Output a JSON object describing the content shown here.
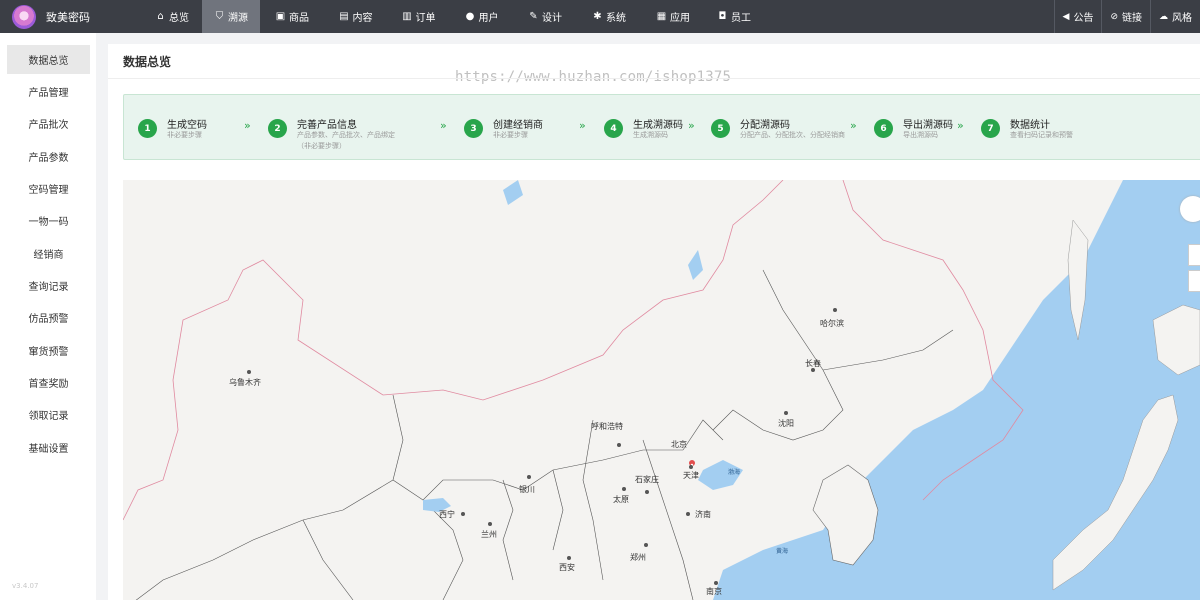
{
  "app": {
    "name": "致美密码",
    "version": "v3.4.07"
  },
  "nav": [
    {
      "label": "总览",
      "icon": "home-icon",
      "active": false
    },
    {
      "label": "溯源",
      "icon": "shield-icon",
      "active": true
    },
    {
      "label": "商品",
      "icon": "bag-icon",
      "active": false
    },
    {
      "label": "内容",
      "icon": "document-icon",
      "active": false
    },
    {
      "label": "订单",
      "icon": "file-icon",
      "active": false
    },
    {
      "label": "用户",
      "icon": "user-icon",
      "active": false
    },
    {
      "label": "设计",
      "icon": "brush-icon",
      "active": false
    },
    {
      "label": "系统",
      "icon": "gear-icon",
      "active": false
    },
    {
      "label": "应用",
      "icon": "grid-icon",
      "active": false
    },
    {
      "label": "员工",
      "icon": "lock-icon",
      "active": false
    }
  ],
  "tools": [
    {
      "label": "公告",
      "icon": "speaker-icon"
    },
    {
      "label": "链接",
      "icon": "link-icon"
    },
    {
      "label": "风格",
      "icon": "cloud-icon"
    }
  ],
  "sidebar": [
    {
      "label": "数据总览",
      "active": true
    },
    {
      "label": "产品管理"
    },
    {
      "label": "产品批次"
    },
    {
      "label": "产品参数"
    },
    {
      "label": "空码管理"
    },
    {
      "label": "一物一码"
    },
    {
      "label": "经销商"
    },
    {
      "label": "查询记录"
    },
    {
      "label": "仿品预警"
    },
    {
      "label": "窜货预警"
    },
    {
      "label": "首查奖励"
    },
    {
      "label": "领取记录"
    },
    {
      "label": "基础设置"
    }
  ],
  "page": {
    "title": "数据总览",
    "watermark": "https://www.huzhan.com/ishop1375"
  },
  "steps": [
    {
      "num": "1",
      "title": "生成空码",
      "desc": "非必要步骤"
    },
    {
      "num": "2",
      "title": "完善产品信息",
      "desc": "产品参数、产品批次、产品绑定（非必要步骤）"
    },
    {
      "num": "3",
      "title": "创建经销商",
      "desc": "非必要步骤"
    },
    {
      "num": "4",
      "title": "生成溯源码",
      "desc": "生成溯源码"
    },
    {
      "num": "5",
      "title": "分配溯源码",
      "desc": "分配产品、分配批次、分配经销商"
    },
    {
      "num": "6",
      "title": "导出溯源码",
      "desc": "导出溯源码"
    },
    {
      "num": "7",
      "title": "数据统计",
      "desc": "查看扫码记录和预警"
    }
  ],
  "step_arrow": "»",
  "map": {
    "cities": [
      "乌鲁木齐",
      "哈尔滨",
      "长春",
      "沈阳",
      "呼和浩特",
      "北京",
      "天津",
      "石家庄",
      "太原",
      "银川",
      "西宁",
      "兰州",
      "济南",
      "郑州",
      "西安",
      "南京"
    ],
    "seas": [
      "渤海",
      "黄海"
    ]
  },
  "colors": {
    "accent": "#28a54b",
    "topbar": "#3b3e45",
    "water": "#a3cef1"
  }
}
